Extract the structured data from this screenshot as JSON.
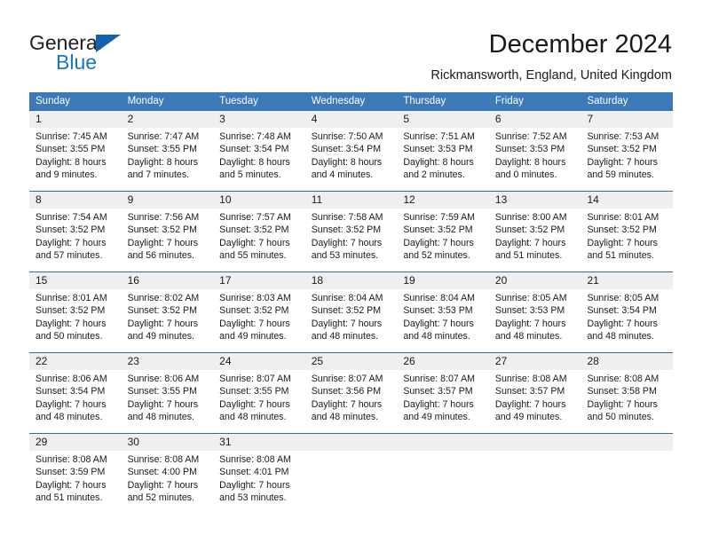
{
  "brand": {
    "name_part1": "General",
    "name_part2": "Blue",
    "triangle_color": "#1461ad",
    "blue_color": "#1477c7"
  },
  "header": {
    "title": "December 2024",
    "location": "Rickmansworth, England, United Kingdom"
  },
  "calendar": {
    "accent_color": "#3b79b8",
    "daynumber_band_color": "#efefef",
    "weekdays": [
      "Sunday",
      "Monday",
      "Tuesday",
      "Wednesday",
      "Thursday",
      "Friday",
      "Saturday"
    ],
    "weeks": [
      {
        "days": [
          {
            "num": "1",
            "sunrise": "Sunrise: 7:45 AM",
            "sunset": "Sunset: 3:55 PM",
            "daylight1": "Daylight: 8 hours",
            "daylight2": "and 9 minutes."
          },
          {
            "num": "2",
            "sunrise": "Sunrise: 7:47 AM",
            "sunset": "Sunset: 3:55 PM",
            "daylight1": "Daylight: 8 hours",
            "daylight2": "and 7 minutes."
          },
          {
            "num": "3",
            "sunrise": "Sunrise: 7:48 AM",
            "sunset": "Sunset: 3:54 PM",
            "daylight1": "Daylight: 8 hours",
            "daylight2": "and 5 minutes."
          },
          {
            "num": "4",
            "sunrise": "Sunrise: 7:50 AM",
            "sunset": "Sunset: 3:54 PM",
            "daylight1": "Daylight: 8 hours",
            "daylight2": "and 4 minutes."
          },
          {
            "num": "5",
            "sunrise": "Sunrise: 7:51 AM",
            "sunset": "Sunset: 3:53 PM",
            "daylight1": "Daylight: 8 hours",
            "daylight2": "and 2 minutes."
          },
          {
            "num": "6",
            "sunrise": "Sunrise: 7:52 AM",
            "sunset": "Sunset: 3:53 PM",
            "daylight1": "Daylight: 8 hours",
            "daylight2": "and 0 minutes."
          },
          {
            "num": "7",
            "sunrise": "Sunrise: 7:53 AM",
            "sunset": "Sunset: 3:52 PM",
            "daylight1": "Daylight: 7 hours",
            "daylight2": "and 59 minutes."
          }
        ]
      },
      {
        "days": [
          {
            "num": "8",
            "sunrise": "Sunrise: 7:54 AM",
            "sunset": "Sunset: 3:52 PM",
            "daylight1": "Daylight: 7 hours",
            "daylight2": "and 57 minutes."
          },
          {
            "num": "9",
            "sunrise": "Sunrise: 7:56 AM",
            "sunset": "Sunset: 3:52 PM",
            "daylight1": "Daylight: 7 hours",
            "daylight2": "and 56 minutes."
          },
          {
            "num": "10",
            "sunrise": "Sunrise: 7:57 AM",
            "sunset": "Sunset: 3:52 PM",
            "daylight1": "Daylight: 7 hours",
            "daylight2": "and 55 minutes."
          },
          {
            "num": "11",
            "sunrise": "Sunrise: 7:58 AM",
            "sunset": "Sunset: 3:52 PM",
            "daylight1": "Daylight: 7 hours",
            "daylight2": "and 53 minutes."
          },
          {
            "num": "12",
            "sunrise": "Sunrise: 7:59 AM",
            "sunset": "Sunset: 3:52 PM",
            "daylight1": "Daylight: 7 hours",
            "daylight2": "and 52 minutes."
          },
          {
            "num": "13",
            "sunrise": "Sunrise: 8:00 AM",
            "sunset": "Sunset: 3:52 PM",
            "daylight1": "Daylight: 7 hours",
            "daylight2": "and 51 minutes."
          },
          {
            "num": "14",
            "sunrise": "Sunrise: 8:01 AM",
            "sunset": "Sunset: 3:52 PM",
            "daylight1": "Daylight: 7 hours",
            "daylight2": "and 51 minutes."
          }
        ]
      },
      {
        "days": [
          {
            "num": "15",
            "sunrise": "Sunrise: 8:01 AM",
            "sunset": "Sunset: 3:52 PM",
            "daylight1": "Daylight: 7 hours",
            "daylight2": "and 50 minutes."
          },
          {
            "num": "16",
            "sunrise": "Sunrise: 8:02 AM",
            "sunset": "Sunset: 3:52 PM",
            "daylight1": "Daylight: 7 hours",
            "daylight2": "and 49 minutes."
          },
          {
            "num": "17",
            "sunrise": "Sunrise: 8:03 AM",
            "sunset": "Sunset: 3:52 PM",
            "daylight1": "Daylight: 7 hours",
            "daylight2": "and 49 minutes."
          },
          {
            "num": "18",
            "sunrise": "Sunrise: 8:04 AM",
            "sunset": "Sunset: 3:52 PM",
            "daylight1": "Daylight: 7 hours",
            "daylight2": "and 48 minutes."
          },
          {
            "num": "19",
            "sunrise": "Sunrise: 8:04 AM",
            "sunset": "Sunset: 3:53 PM",
            "daylight1": "Daylight: 7 hours",
            "daylight2": "and 48 minutes."
          },
          {
            "num": "20",
            "sunrise": "Sunrise: 8:05 AM",
            "sunset": "Sunset: 3:53 PM",
            "daylight1": "Daylight: 7 hours",
            "daylight2": "and 48 minutes."
          },
          {
            "num": "21",
            "sunrise": "Sunrise: 8:05 AM",
            "sunset": "Sunset: 3:54 PM",
            "daylight1": "Daylight: 7 hours",
            "daylight2": "and 48 minutes."
          }
        ]
      },
      {
        "days": [
          {
            "num": "22",
            "sunrise": "Sunrise: 8:06 AM",
            "sunset": "Sunset: 3:54 PM",
            "daylight1": "Daylight: 7 hours",
            "daylight2": "and 48 minutes."
          },
          {
            "num": "23",
            "sunrise": "Sunrise: 8:06 AM",
            "sunset": "Sunset: 3:55 PM",
            "daylight1": "Daylight: 7 hours",
            "daylight2": "and 48 minutes."
          },
          {
            "num": "24",
            "sunrise": "Sunrise: 8:07 AM",
            "sunset": "Sunset: 3:55 PM",
            "daylight1": "Daylight: 7 hours",
            "daylight2": "and 48 minutes."
          },
          {
            "num": "25",
            "sunrise": "Sunrise: 8:07 AM",
            "sunset": "Sunset: 3:56 PM",
            "daylight1": "Daylight: 7 hours",
            "daylight2": "and 48 minutes."
          },
          {
            "num": "26",
            "sunrise": "Sunrise: 8:07 AM",
            "sunset": "Sunset: 3:57 PM",
            "daylight1": "Daylight: 7 hours",
            "daylight2": "and 49 minutes."
          },
          {
            "num": "27",
            "sunrise": "Sunrise: 8:08 AM",
            "sunset": "Sunset: 3:57 PM",
            "daylight1": "Daylight: 7 hours",
            "daylight2": "and 49 minutes."
          },
          {
            "num": "28",
            "sunrise": "Sunrise: 8:08 AM",
            "sunset": "Sunset: 3:58 PM",
            "daylight1": "Daylight: 7 hours",
            "daylight2": "and 50 minutes."
          }
        ]
      },
      {
        "days": [
          {
            "num": "29",
            "sunrise": "Sunrise: 8:08 AM",
            "sunset": "Sunset: 3:59 PM",
            "daylight1": "Daylight: 7 hours",
            "daylight2": "and 51 minutes."
          },
          {
            "num": "30",
            "sunrise": "Sunrise: 8:08 AM",
            "sunset": "Sunset: 4:00 PM",
            "daylight1": "Daylight: 7 hours",
            "daylight2": "and 52 minutes."
          },
          {
            "num": "31",
            "sunrise": "Sunrise: 8:08 AM",
            "sunset": "Sunset: 4:01 PM",
            "daylight1": "Daylight: 7 hours",
            "daylight2": "and 53 minutes."
          },
          {
            "num": "",
            "sunrise": "",
            "sunset": "",
            "daylight1": "",
            "daylight2": ""
          },
          {
            "num": "",
            "sunrise": "",
            "sunset": "",
            "daylight1": "",
            "daylight2": ""
          },
          {
            "num": "",
            "sunrise": "",
            "sunset": "",
            "daylight1": "",
            "daylight2": ""
          },
          {
            "num": "",
            "sunrise": "",
            "sunset": "",
            "daylight1": "",
            "daylight2": ""
          }
        ]
      }
    ]
  }
}
